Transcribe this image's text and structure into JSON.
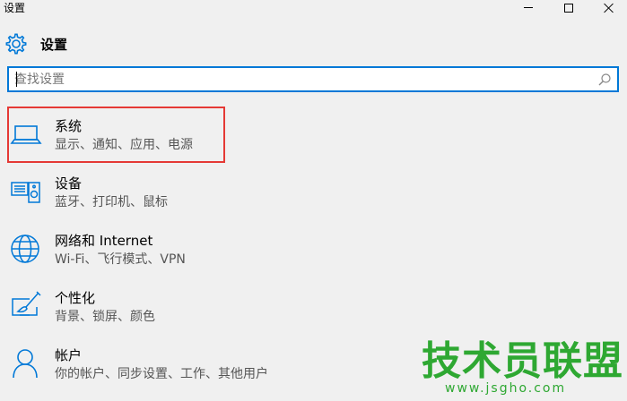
{
  "window": {
    "title": "设置",
    "controls": [
      "minimize-icon",
      "maximize-icon",
      "close-icon"
    ]
  },
  "header": {
    "title": "设置",
    "icon": "gear-icon"
  },
  "search": {
    "value": "",
    "placeholder": "查找设置",
    "icon": "search-icon"
  },
  "items": [
    {
      "title": "系统",
      "subtitle": "显示、通知、应用、电源",
      "icon": "laptop-icon",
      "selected": true
    },
    {
      "title": "设备",
      "subtitle": "蓝牙、打印机、鼠标",
      "icon": "devices-icon"
    },
    {
      "title": "网络和 Internet",
      "subtitle": "Wi-Fi、飞行模式、VPN",
      "icon": "globe-icon"
    },
    {
      "title": "个性化",
      "subtitle": "背景、锁屏、颜色",
      "icon": "personalization-icon"
    },
    {
      "title": "帐户",
      "subtitle": "你的帐户、同步设置、工作、其他用户",
      "icon": "person-icon"
    }
  ],
  "watermark": {
    "main": "技术员联盟",
    "sub": "www.jsgho.com"
  },
  "colors": {
    "accent": "#0078d7",
    "highlight": "#e53935",
    "background": "#f0f0f0",
    "watermark": "#2ea832"
  }
}
